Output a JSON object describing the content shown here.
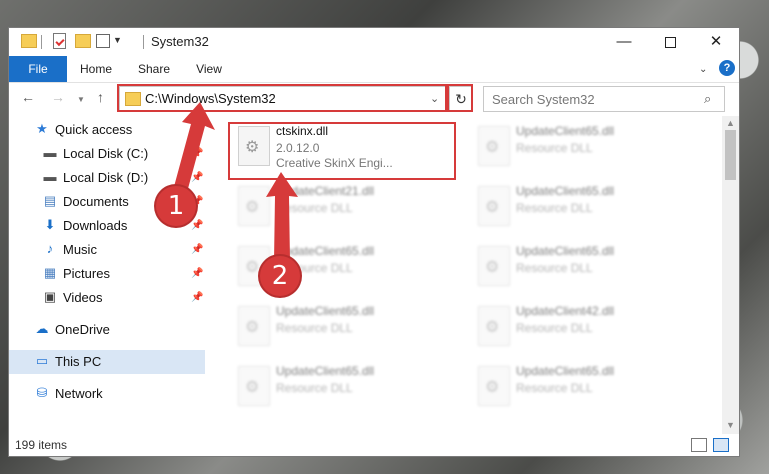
{
  "window": {
    "title": "System32",
    "minimize_glyph": "—",
    "close_glyph": "✕"
  },
  "ribbon": {
    "file": "File",
    "home": "Home",
    "share": "Share",
    "view": "View",
    "help_glyph": "?"
  },
  "nav": {
    "back_glyph": "←",
    "forward_glyph": "→",
    "up_glyph": "↑",
    "address": "C:\\Windows\\System32",
    "refresh_glyph": "↻",
    "search_placeholder": "Search System32"
  },
  "sidebar": {
    "items": [
      {
        "label": "Quick access",
        "icon": "star-icon",
        "glyph": "★",
        "color": "#2d7bd6"
      },
      {
        "label": "Local Disk (C:)",
        "icon": "drive-icon",
        "glyph": "▬",
        "color": "#555"
      },
      {
        "label": "Local Disk (D:)",
        "icon": "drive-icon",
        "glyph": "▬",
        "color": "#555"
      },
      {
        "label": "Documents",
        "icon": "documents-icon",
        "glyph": "▤",
        "color": "#4a7fc0"
      },
      {
        "label": "Downloads",
        "icon": "downloads-icon",
        "glyph": "⬇",
        "color": "#1a6fc8"
      },
      {
        "label": "Music",
        "icon": "music-icon",
        "glyph": "♪",
        "color": "#1a6fc8"
      },
      {
        "label": "Pictures",
        "icon": "pictures-icon",
        "glyph": "▦",
        "color": "#4a7fc0"
      },
      {
        "label": "Videos",
        "icon": "videos-icon",
        "glyph": "▣",
        "color": "#444"
      },
      {
        "label": "OneDrive",
        "icon": "onedrive-icon",
        "glyph": "☁",
        "color": "#1a6fc8"
      },
      {
        "label": "This PC",
        "icon": "this-pc-icon",
        "glyph": "▭",
        "color": "#2d7bd6"
      },
      {
        "label": "Network",
        "icon": "network-icon",
        "glyph": "⛁",
        "color": "#2d7bd6"
      }
    ]
  },
  "files": {
    "highlighted": {
      "name": "ctskinx.dll",
      "version": "2.0.12.0",
      "description": "Creative SkinX Engi..."
    },
    "others": [
      {
        "name": "UpdateClient65.dll",
        "type": "Resource DLL"
      },
      {
        "name": "UpdateClient21.dll",
        "type": "Resource DLL"
      },
      {
        "name": "UpdateClient65.dll",
        "type": "Resource DLL"
      },
      {
        "name": "UpdateClient65.dll",
        "type": "Resource DLL"
      },
      {
        "name": "UpdateClient65.dll",
        "type": "Resource DLL"
      },
      {
        "name": "UpdateClient65.dll",
        "type": "Resource DLL"
      },
      {
        "name": "UpdateClient42.dll",
        "type": "Resource DLL"
      },
      {
        "name": "UpdateClient65.dll",
        "type": "Resource DLL"
      },
      {
        "name": "UpdateClient65.dll",
        "type": "Resource DLL"
      }
    ]
  },
  "status": {
    "item_count": "199 items"
  },
  "callouts": {
    "one": "1",
    "two": "2"
  },
  "colors": {
    "accent": "#1a6fc8",
    "highlight": "#d63a3a"
  }
}
